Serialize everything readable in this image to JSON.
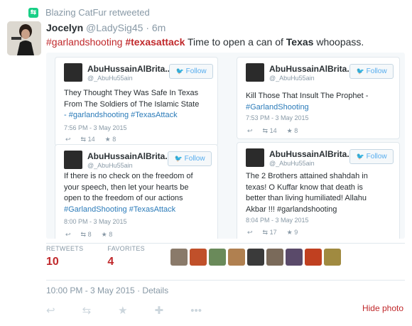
{
  "retweeted_by": "Blazing CatFur retweeted",
  "author": {
    "name": "Jocelyn",
    "handle": "@LadySig45",
    "time": "· 6m"
  },
  "tweet": {
    "parts": [
      {
        "text": "#garlandshooting",
        "style": "hash"
      },
      {
        "text": " ",
        "style": "plain"
      },
      {
        "text": "#texasattack",
        "style": "hashbold"
      },
      {
        "text": "  Time to open a can of ",
        "style": "plain"
      },
      {
        "text": "Texas",
        "style": "bold"
      },
      {
        "text": " whoopass.",
        "style": "plain"
      }
    ]
  },
  "embedded": [
    {
      "name": "AbuHussainAlBrita...",
      "handle": "@_AbuHu55ain",
      "follow": "Follow",
      "lines": [
        "They Thought They Was Safe In Texas",
        "From The Soldiers of The Islamic State",
        "- #garlandshooting #TexasAttack"
      ],
      "time": "7:56 PM - 3 May 2015",
      "retweets": "14",
      "favorites": "8"
    },
    {
      "name": "AbuHussainAlBrita...",
      "handle": "@_AbuHu55ain",
      "follow": "Follow",
      "lines": [
        "Kill Those That Insult The Prophet -",
        "#GarlandShooting"
      ],
      "time": "7:53 PM - 3 May 2015",
      "retweets": "14",
      "favorites": "8"
    },
    {
      "name": "AbuHussainAlBrita...",
      "handle": "@_AbuHu55ain",
      "follow": "Follow",
      "lines": [
        "If there is no check on the freedom of",
        "your speech, then let your hearts be",
        "open to the freedom of our actions",
        "#GarlandShooting #TexasAttack"
      ],
      "time": "8:00 PM - 3 May 2015",
      "retweets": "8",
      "favorites": "8"
    },
    {
      "name": "AbuHussainAlBrita...",
      "handle": "@_AbuHu55ain",
      "follow": "Follow",
      "lines": [
        "The 2 Brothers attained shahdah in",
        "texas! O Kuffar know that death is",
        "better than living humiliated! Allahu",
        "Akbar !!! #garlandshooting"
      ],
      "time": "8:04 PM - 3 May 2015",
      "retweets": "17",
      "favorites": "9"
    }
  ],
  "stats": {
    "retweets_label": "RETWEETS",
    "retweets_value": "10",
    "favorites_label": "FAVORITES",
    "favorites_value": "4"
  },
  "face_colors": [
    "#8a7a6a",
    "#c0502a",
    "#6a8a5a",
    "#b08050",
    "#3a3a3a",
    "#7a6a5a",
    "#5a4a6a",
    "#c04020",
    "#a08a40"
  ],
  "timestamp": "10:00 PM - 3 May 2015 · Details",
  "hide_photo": "Hide photo",
  "colors": {
    "accent": "#c0282b",
    "link": "#2b7bb9",
    "muted": "#8899a6"
  }
}
